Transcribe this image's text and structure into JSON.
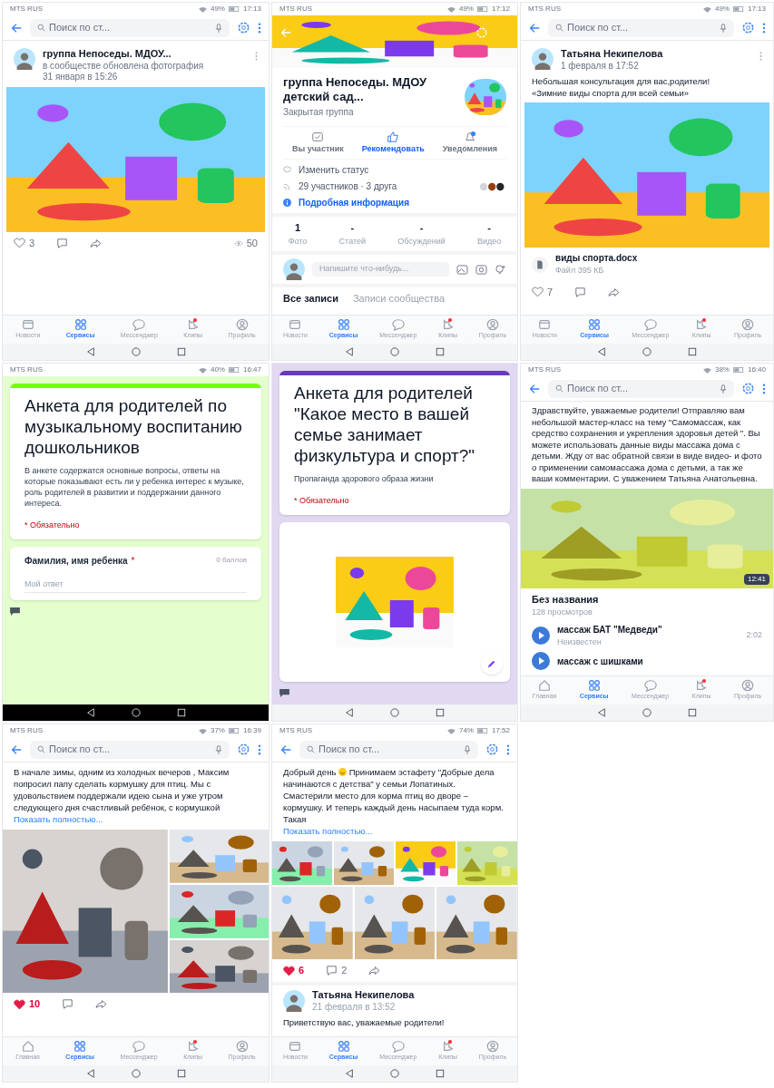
{
  "screens": [
    {
      "kind": "post",
      "status_bar": {
        "carrier": "MTS RUS",
        "battery": "49%",
        "time": "17:13"
      },
      "search": {
        "placeholder": "Поиск по ст..."
      },
      "post": {
        "author": "группа Непоседы. МДОУ...",
        "action": "в сообществе обновлена фотография",
        "date": "31 января в 15:26",
        "likes": "3",
        "liked": false,
        "views": "50"
      },
      "nav": [
        {
          "kind": "news",
          "label": "Новости",
          "selected": false,
          "dot": false
        },
        {
          "kind": "services",
          "label": "Сервисы",
          "selected": true,
          "dot": false
        },
        {
          "kind": "messenger",
          "label": "Мессенджер",
          "selected": false,
          "dot": false
        },
        {
          "kind": "clips",
          "label": "Клипы",
          "selected": false,
          "dot": true
        },
        {
          "kind": "profile",
          "label": "Профиль",
          "selected": false,
          "dot": false
        }
      ]
    },
    {
      "kind": "group",
      "status_bar": {
        "carrier": "MTS RUS",
        "battery": "49%",
        "time": "17:12"
      },
      "group": {
        "name": "группа Непоседы. МДОУ детский сад...",
        "type": "Закрытая группа",
        "actions": [
          {
            "kind": "member",
            "label": "Вы участник",
            "primary": false
          },
          {
            "kind": "recommend",
            "label": "Рекомендовать",
            "primary": true
          },
          {
            "kind": "notify",
            "label": "Уведомления",
            "primary": false
          }
        ],
        "status": "Изменить статус",
        "members": "29 участников · 3 друга",
        "info": "Подробная информация",
        "counters": [
          {
            "value": "1",
            "label": "Фото"
          },
          {
            "value": "-",
            "label": "Статей"
          },
          {
            "value": "-",
            "label": "Обсуждений"
          },
          {
            "value": "-",
            "label": "Видео"
          }
        ],
        "composer": {
          "placeholder": "Напишите что-нибудь..."
        },
        "tabs": [
          {
            "label": "Все записи",
            "selected": true
          },
          {
            "label": "Записи сообщества",
            "selected": false
          }
        ]
      },
      "nav": [
        {
          "kind": "news",
          "label": "Новости",
          "selected": false,
          "dot": false
        },
        {
          "kind": "services",
          "label": "Сервисы",
          "selected": true,
          "dot": false
        },
        {
          "kind": "messenger",
          "label": "Мессенджер",
          "selected": false,
          "dot": false
        },
        {
          "kind": "clips",
          "label": "Клипы",
          "selected": false,
          "dot": true
        },
        {
          "kind": "profile",
          "label": "Профиль",
          "selected": false,
          "dot": false
        }
      ]
    },
    {
      "kind": "post",
      "status_bar": {
        "carrier": "MTS RUS",
        "battery": "49%",
        "time": "17:13"
      },
      "search": {
        "placeholder": "Поиск по ст..."
      },
      "post": {
        "author": "Татьяна Некипелова",
        "date": "1 февраля в 17:52",
        "text": "Небольшая консультация для вас,родители!\n«Зимние виды спорта для всей семьи»",
        "file": {
          "name": "виды спорта.docx",
          "size": "Файл 395 КБ"
        },
        "likes": "7",
        "liked": false
      },
      "nav": [
        {
          "kind": "news",
          "label": "Новости",
          "selected": false,
          "dot": false
        },
        {
          "kind": "services",
          "label": "Сервисы",
          "selected": true,
          "dot": false
        },
        {
          "kind": "messenger",
          "label": "Мессенджер",
          "selected": false,
          "dot": false
        },
        {
          "kind": "clips",
          "label": "Клипы",
          "selected": false,
          "dot": true
        },
        {
          "kind": "profile",
          "label": "Профиль",
          "selected": false,
          "dot": false
        }
      ]
    },
    {
      "kind": "form",
      "status_bar": {
        "carrier": "MTS RUS",
        "battery": "40%",
        "time": "16:47"
      },
      "form": {
        "color": "#76ff03",
        "title": "Анкета для родителей по музыкальному воспитанию дошкольников",
        "description": "В анкете содержатся основные вопросы, ответы на которые показывают есть ли у ребенка интерес к музыке, роль родителей в развитии и поддержании данного интереса.",
        "required": "* Обязательно",
        "question": {
          "label": "Фамилия, имя ребенка",
          "mark": "*",
          "points": "0 баллов",
          "placeholder": "Мой ответ"
        }
      }
    },
    {
      "kind": "form",
      "form": {
        "color": "#673ab7",
        "title": "Анкета для родителей \"Какое место в вашей семье занимает физкультура и спорт?\"",
        "description": "Пропаганда здорового образа жизни",
        "required": "* Обязательно"
      }
    },
    {
      "kind": "video_post",
      "status_bar": {
        "carrier": "MTS RUS",
        "battery": "38%",
        "time": "16:40"
      },
      "search": {
        "placeholder": "Поиск по ст..."
      },
      "post": {
        "text": "Здравствуйте, уважаемые родители! Отправляю вам небольшой мастер-класс на тему \"Самомассаж, как средство сохранения и укрепления здоровья детей \". Вы можете использовать данные виды массажа дома с детьми. Жду от вас обратной связи в виде видео- и фото о применении самомассажа дома с детьми, а так же ваши комментарии. С уважением Татьяна Анатольевна.",
        "video": {
          "duration": "12:41",
          "title": "Без названия",
          "views": "128 просмотров"
        },
        "audio": [
          {
            "title": "массаж БАТ \"Медведи\"",
            "artist": "Неизвестен",
            "duration": "2:02"
          },
          {
            "title": "массаж с шишками"
          }
        ]
      },
      "nav": [
        {
          "kind": "home",
          "label": "Главная",
          "selected": false,
          "dot": false
        },
        {
          "kind": "services",
          "label": "Сервисы",
          "selected": true,
          "dot": false
        },
        {
          "kind": "messenger",
          "label": "Мессенджер",
          "selected": false,
          "dot": false
        },
        {
          "kind": "clips",
          "label": "Клипы",
          "selected": false,
          "dot": true
        },
        {
          "kind": "profile",
          "label": "Профиль",
          "selected": false,
          "dot": false
        }
      ]
    },
    {
      "kind": "post",
      "status_bar": {
        "carrier": "MTS RUS",
        "battery": "37%",
        "time": "16:39"
      },
      "search": {
        "placeholder": "Поиск по ст..."
      },
      "post": {
        "text": "В начале зимы,  одним из холодных вечеров , Максим попросил папу сделать кормушку для птиц.  Мы с удовольствием поддержали идею сына и уже утром следующего дня счастливый ребёнок,  с кормушкой",
        "more": "Показать полностью...",
        "likes": "10",
        "liked": true
      },
      "nav": [
        {
          "kind": "home",
          "label": "Главная",
          "selected": false,
          "dot": false
        },
        {
          "kind": "services",
          "label": "Сервисы",
          "selected": true,
          "dot": false
        },
        {
          "kind": "messenger",
          "label": "Мессенджер",
          "selected": false,
          "dot": false
        },
        {
          "kind": "clips",
          "label": "Клипы",
          "selected": false,
          "dot": true
        },
        {
          "kind": "profile",
          "label": "Профиль",
          "selected": false,
          "dot": false
        }
      ]
    },
    {
      "kind": "post",
      "status_bar": {
        "carrier": "MTS RUS",
        "battery": "74%",
        "time": "17:52"
      },
      "search": {
        "placeholder": "Поиск по ст..."
      },
      "post": {
        "lead": "Добрый день",
        "text": "Принимаем эстафету \"Добрые дела начинаются с детства\" у семьи Лопатиных. Смастерили место для корма птиц во дворе –кормушку. И теперь каждый день насыпаем туда корм. Такая",
        "more": "Показать полностью...",
        "likes": "6",
        "liked": true,
        "comments": "2",
        "next": {
          "author": "Татьяна Некипелова",
          "date": "21 февраля в 13:52",
          "text": "Приветствую вас, уважаемые родители!"
        }
      },
      "nav": [
        {
          "kind": "news",
          "label": "Новости",
          "selected": false,
          "dot": false
        },
        {
          "kind": "services",
          "label": "Сервисы",
          "selected": true,
          "dot": false
        },
        {
          "kind": "messenger",
          "label": "Мессенджер",
          "selected": false,
          "dot": false
        },
        {
          "kind": "clips",
          "label": "Клипы",
          "selected": false,
          "dot": true
        },
        {
          "kind": "profile",
          "label": "Профиль",
          "selected": false,
          "dot": false
        }
      ]
    }
  ]
}
